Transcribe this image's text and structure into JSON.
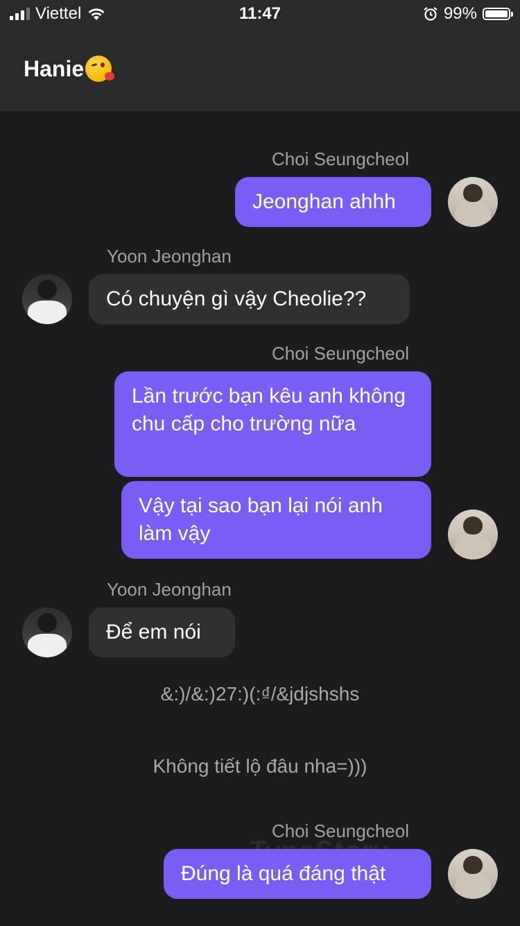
{
  "status_bar": {
    "carrier": "Viettel",
    "time": "11:47",
    "battery": "99%"
  },
  "header": {
    "title": "Hanie",
    "emoji": "kissing-face-with-heart"
  },
  "colors": {
    "background": "#1c1c1e",
    "header": "#2a2a2c",
    "my_bubble": "#7b5cf5",
    "their_bubble": "#303033"
  },
  "messages": [
    {
      "sender": "Choi Seungcheol",
      "text": "Jeonghan ahhh"
    },
    {
      "sender": "Yoon Jeonghan",
      "text": "Có chuyện gì vậy Cheolie??"
    },
    {
      "sender": "Choi Seungcheol",
      "text": "Lần trước bạn kêu anh không chu cấp cho trường nữa"
    },
    {
      "sender": "Choi Seungcheol",
      "text": "Vậy tại sao bạn lại nói anh làm vậy"
    },
    {
      "sender": "Yoon Jeonghan",
      "text": "Để em nói"
    },
    {
      "narration": "&:)/&:)27:)(:₫/&jdjshshs"
    },
    {
      "narration": "Không tiết lộ đâu nha=)))"
    },
    {
      "sender": "Choi Seungcheol",
      "text": "Đúng là quá đáng thật"
    }
  ],
  "watermark": "TypeStory"
}
